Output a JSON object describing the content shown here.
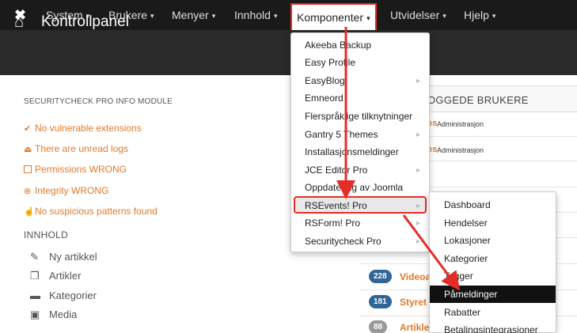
{
  "topnav": {
    "logo": "✖",
    "items": [
      {
        "label": "System"
      },
      {
        "label": "Brukere"
      },
      {
        "label": "Menyer"
      },
      {
        "label": "Innhold"
      },
      {
        "label": "Komponenter"
      },
      {
        "label": "Utvidelser"
      },
      {
        "label": "Hjelp"
      }
    ],
    "caret": "▾"
  },
  "header": {
    "title": "Kontrollpanel"
  },
  "securitycheck": {
    "title": "SECURITYCHECK PRO INFO MODULE",
    "statuses": [
      {
        "icon": "check-icon",
        "text": "No vulnerable extensions"
      },
      {
        "icon": "warning-icon",
        "text": "There are unread logs"
      },
      {
        "icon": "checkbox-icon",
        "text": "Permissions WRONG"
      },
      {
        "icon": "error-icon",
        "text": "Integrity WRONG"
      },
      {
        "icon": "thumb-icon",
        "text": "No suspicious patterns found"
      }
    ]
  },
  "content": {
    "title": "INNHOLD",
    "items": [
      {
        "icon": "pencil-icon",
        "label": "Ny artikkel"
      },
      {
        "icon": "copy-icon",
        "label": "Artikler"
      },
      {
        "icon": "folder-icon",
        "label": "Kategorier"
      },
      {
        "icon": "image-icon",
        "label": "Media"
      }
    ]
  },
  "logged_users": {
    "title": "OGGEDE BRUKERE",
    "rows": [
      {
        "name": "es",
        "role": "Administrasjon"
      },
      {
        "name": "es",
        "role": "Administrasjon"
      }
    ]
  },
  "articles": [
    {
      "count": "228",
      "title": "Videoa"
    },
    {
      "count": "181",
      "title": "Styret"
    },
    {
      "count": "88",
      "title": "Artikler"
    }
  ],
  "dropdown": {
    "items": [
      {
        "label": "Akeeba Backup",
        "has_sub": false
      },
      {
        "label": "Easy Profile",
        "has_sub": false
      },
      {
        "label": "EasyBlog",
        "has_sub": true
      },
      {
        "label": "Emneord",
        "has_sub": false
      },
      {
        "label": "Flerspråklige tilknytninger",
        "has_sub": false
      },
      {
        "label": "Gantry 5 Themes",
        "has_sub": true
      },
      {
        "label": "Installasjonsmeldinger",
        "has_sub": false
      },
      {
        "label": "JCE Editor Pro",
        "has_sub": true
      },
      {
        "label": "Oppdatering av Joomla",
        "has_sub": false
      },
      {
        "label": "RSEvents! Pro",
        "has_sub": true
      },
      {
        "label": "RSForm! Pro",
        "has_sub": true
      },
      {
        "label": "Securitycheck Pro",
        "has_sub": true
      }
    ],
    "arrow": "▸"
  },
  "submenu": {
    "items": [
      {
        "label": "Dashboard"
      },
      {
        "label": "Hendelser"
      },
      {
        "label": "Lokasjoner"
      },
      {
        "label": "Kategorier"
      },
      {
        "label": "Tagger"
      },
      {
        "label": "Påmeldinger"
      },
      {
        "label": "Rabatter"
      },
      {
        "label": "Betalingsintegrasjoner"
      }
    ]
  },
  "colors": {
    "accent": "#e52d27",
    "orange": "#e07a2a",
    "badge": "#2f6696",
    "topbar": "#1a1a1a"
  }
}
